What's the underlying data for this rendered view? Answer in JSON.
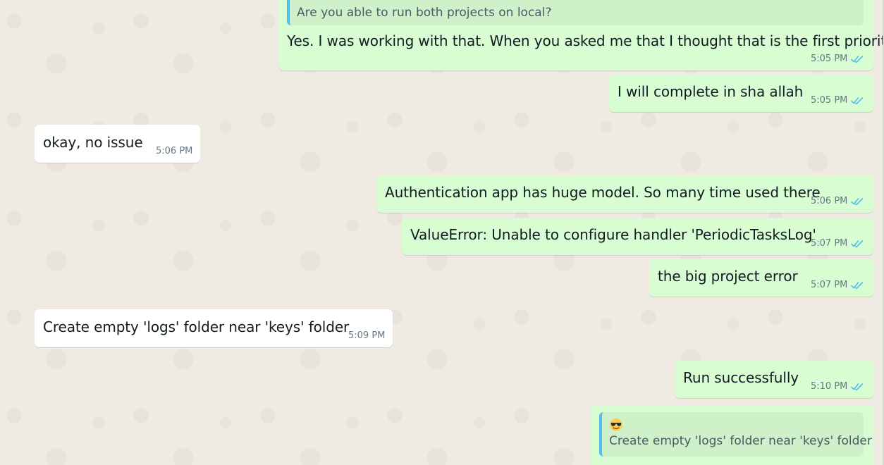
{
  "colors": {
    "outgoing_bubble": "#d9fdd3",
    "incoming_bubble": "#ffffff",
    "read_ticks": "#53bdeb",
    "quote_bar": "#53bdeb",
    "background": "#efeae2"
  },
  "messages": [
    {
      "direction": "outgoing",
      "quoted": "Are you able to run both projects on local?",
      "text": "Yes. I was working with that. When you asked me that I thought that is the first priority.",
      "time": "5:05 PM",
      "status_icon": "double-check-read-icon"
    },
    {
      "direction": "outgoing",
      "text": "I will complete in sha allah",
      "time": "5:05 PM",
      "status_icon": "double-check-read-icon"
    },
    {
      "direction": "incoming",
      "text": "okay, no issue",
      "time": "5:06 PM"
    },
    {
      "direction": "outgoing",
      "text": "Authentication app has huge model. So many time used there",
      "time": "5:06 PM",
      "status_icon": "double-check-read-icon"
    },
    {
      "direction": "outgoing",
      "text": "ValueError: Unable to configure handler 'PeriodicTasksLog'",
      "time": "5:07 PM",
      "status_icon": "double-check-read-icon"
    },
    {
      "direction": "outgoing",
      "text": "the big project error",
      "time": "5:07 PM",
      "status_icon": "double-check-read-icon"
    },
    {
      "direction": "incoming",
      "text": "Create empty 'logs' folder near 'keys' folder",
      "time": "5:09 PM"
    },
    {
      "direction": "outgoing",
      "text": "Run successfully",
      "time": "5:10 PM",
      "status_icon": "double-check-read-icon"
    },
    {
      "direction": "outgoing",
      "quoted_emoji": "smiling-face-with-sunglasses-icon",
      "quoted": "Create empty 'logs' folder near 'keys' folder"
    }
  ]
}
